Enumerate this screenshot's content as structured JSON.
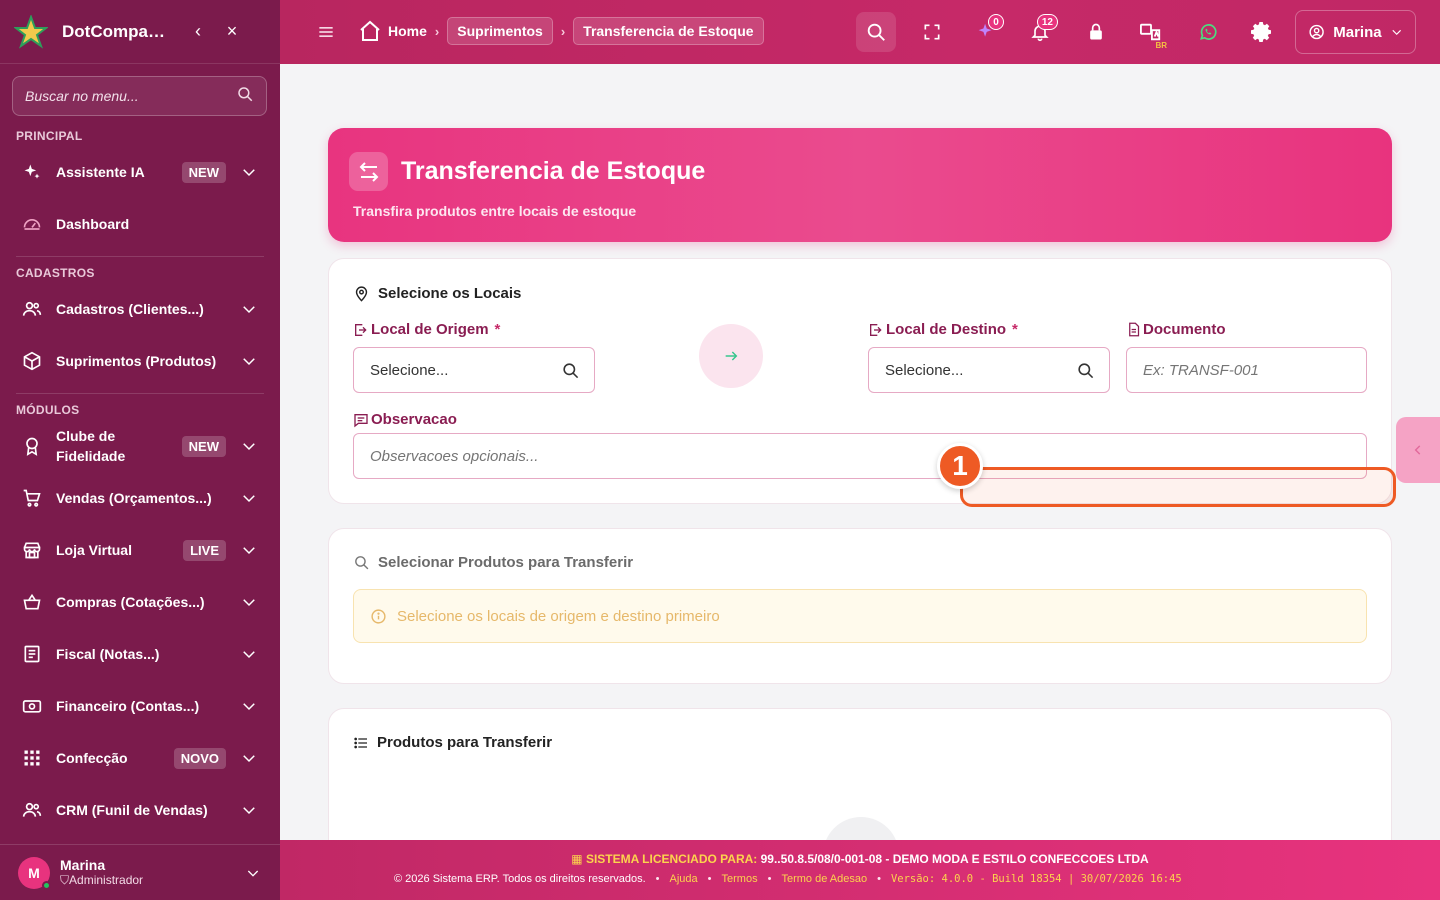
{
  "app": {
    "brand": "DotCompanion",
    "collapse_glyph": "‹",
    "close_glyph": "×"
  },
  "sidebar": {
    "search_placeholder": "Buscar no menu...",
    "sections": {
      "principal": "PRINCIPAL",
      "cadastros": "CADASTROS",
      "modulos": "MÓDULOS"
    },
    "items": [
      {
        "label": "Assistente IA",
        "badge": "NEW",
        "icon": "sparkles-icon"
      },
      {
        "label": "Dashboard",
        "icon": "gauge-icon"
      },
      {
        "label": "Cadastros (Clientes...)",
        "icon": "users-icon"
      },
      {
        "label": "Suprimentos (Produtos)",
        "icon": "box-icon"
      },
      {
        "label": "Clube de Fidelidade",
        "badge": "NEW",
        "icon": "award-icon"
      },
      {
        "label": "Vendas (Orçamentos...)",
        "icon": "cart-icon"
      },
      {
        "label": "Loja Virtual",
        "badge": "LIVE",
        "icon": "store-icon"
      },
      {
        "label": "Compras (Cotações...)",
        "icon": "basket-icon"
      },
      {
        "label": "Fiscal (Notas...)",
        "icon": "receipt-icon"
      },
      {
        "label": "Financeiro (Contas...)",
        "icon": "money-icon"
      },
      {
        "label": "Confecção",
        "badge": "NOVO",
        "icon": "grid-icon"
      },
      {
        "label": "CRM (Funil de Vendas)",
        "icon": "users-icon"
      }
    ],
    "user": {
      "initial": "M",
      "name": "Marina",
      "role": "Administrador"
    }
  },
  "topbar": {
    "breadcrumb": {
      "home": "Home",
      "section": "Suprimentos",
      "current": "Transferencia de Estoque"
    },
    "notifications": {
      "sparkles_count": "0",
      "bell_count": "12"
    },
    "lang_badge": "BR",
    "user_name": "Marina"
  },
  "hero": {
    "title": "Transferencia de Estoque",
    "subtitle": "Transfira produtos entre locais de estoque"
  },
  "locations_card": {
    "title": "Selecione os Locais",
    "origin": {
      "label": "Local de Origem",
      "required": "*",
      "value": "Selecione..."
    },
    "destination": {
      "label": "Local de Destino",
      "required": "*",
      "value": "Selecione..."
    },
    "document": {
      "label": "Documento",
      "placeholder": "Ex: TRANSF-001"
    },
    "notes": {
      "label": "Observacao",
      "placeholder": "Observacoes opcionais..."
    }
  },
  "products_select_card": {
    "title": "Selecionar Produtos para Transferir",
    "warning": "Selecione os locais de origem e destino primeiro"
  },
  "transfer_list_card": {
    "title": "Produtos para Transferir"
  },
  "annotation": {
    "marker": "1"
  },
  "footer": {
    "license_prefix": "SISTEMA LICENCIADO PARA:",
    "license_value": "99..50.8.5/08/0-001-08 - DEMO MODA E ESTILO CONFECCOES LTDA",
    "copyright": "© 2026 Sistema ERP. Todos os direitos reservados.",
    "links": [
      "Ajuda",
      "Termos",
      "Termo de Adesao"
    ],
    "version": "Versão: 4.0.0 - Build 18354 | 30/07/2026 16:45"
  },
  "colors": {
    "sidebar": "#7b1b4c",
    "topbar": "#c62968",
    "accent": "#e8337e",
    "annotation": "#ee5a24"
  }
}
